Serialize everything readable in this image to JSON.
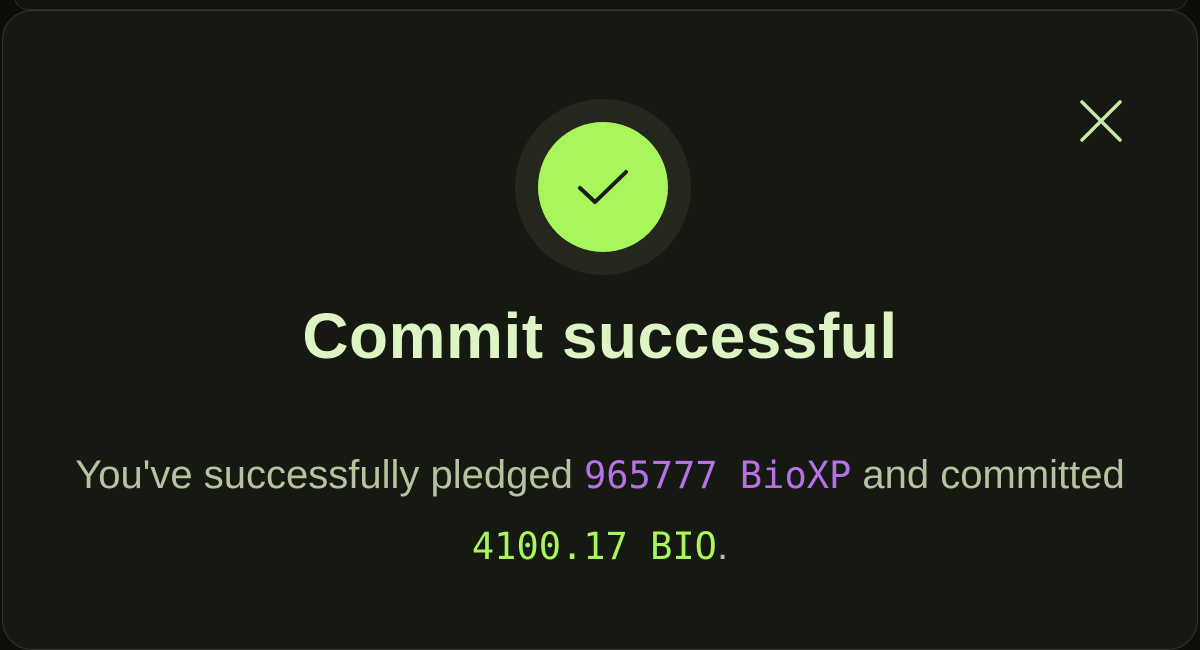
{
  "modal": {
    "title": "Commit successful",
    "message": {
      "prefix": "You've successfully pledged ",
      "bioxp_amount": "965777 BioXP",
      "middle": " and committed ",
      "bio_amount": "4100.17 BIO",
      "suffix": "."
    }
  },
  "icons": {
    "close": "close-icon",
    "success": "checkmark-icon"
  },
  "colors": {
    "accent_green": "#a8f55c",
    "bioxp_purple": "#b870e6",
    "title_text": "#ddf5c4",
    "body_text": "#b4c49e",
    "modal_bg": "#161812"
  }
}
